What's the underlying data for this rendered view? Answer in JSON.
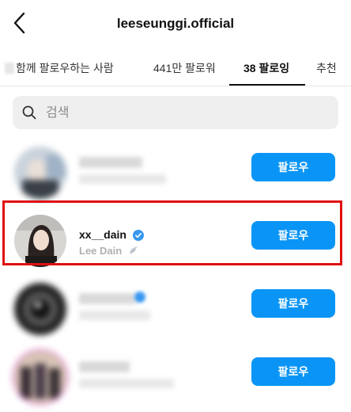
{
  "header": {
    "title": "leeseunggi.official"
  },
  "tabs": {
    "mutual": "함께 팔로우하는 사람",
    "followers": "441만 팔로워",
    "following": "38 팔로잉",
    "recommend": "추천"
  },
  "search": {
    "placeholder": "검색"
  },
  "list": {
    "follow_label": "팔로우",
    "items": [
      {
        "username": "",
        "fullname": "",
        "blurred": true
      },
      {
        "username": "xx__dain",
        "fullname": "Lee Dain",
        "verified": true,
        "blurred": false,
        "highlighted": true
      },
      {
        "username": "",
        "fullname": "",
        "verified": true,
        "blurred": true
      },
      {
        "username": "",
        "fullname": "",
        "blurred": true
      }
    ]
  },
  "colors": {
    "follow_button": "#0a95f6",
    "highlight_border": "#e01010",
    "verified_badge": "#3897f0"
  }
}
